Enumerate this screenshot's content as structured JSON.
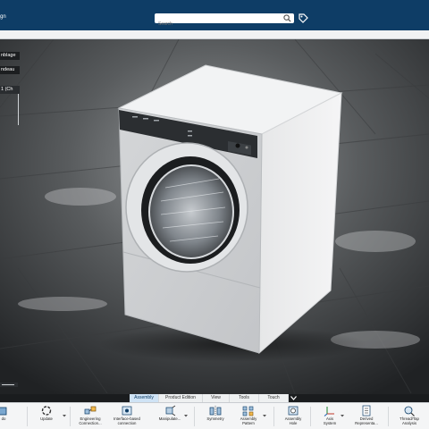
{
  "header": {
    "title_fragment": "gn",
    "search_placeholder": "Search",
    "tag_icon": "tag-icon",
    "search_icon": "search-icon"
  },
  "tree": {
    "items": [
      {
        "label": "nblage"
      },
      {
        "label": "ndeau"
      },
      {
        "label": "1 (Ch"
      }
    ]
  },
  "tabs": [
    {
      "label": "Assembly",
      "active": true
    },
    {
      "label": "Product Edition",
      "active": false
    },
    {
      "label": "View",
      "active": false
    },
    {
      "label": "Tools",
      "active": false
    },
    {
      "label": "Touch",
      "active": false
    }
  ],
  "toolbar": {
    "items": [
      {
        "line1": "do",
        "line2": "",
        "icon": "partial-icon"
      },
      {
        "line1": "Update",
        "line2": "",
        "icon": "update-icon"
      },
      {
        "line1": "Engineering",
        "line2": "Connection...",
        "icon": "engineering-connection-icon"
      },
      {
        "line1": "Interface-based",
        "line2": "connection",
        "icon": "interface-connection-icon"
      },
      {
        "line1": "Manipulate...",
        "line2": "",
        "icon": "manipulate-icon"
      },
      {
        "line1": "Symmetry",
        "line2": "",
        "icon": "symmetry-icon"
      },
      {
        "line1": "Assembly",
        "line2": "Pattern",
        "icon": "assembly-pattern-icon"
      },
      {
        "line1": "Assembly",
        "line2": "Hole",
        "icon": "assembly-hole-icon"
      },
      {
        "line1": "Axis",
        "line2": "System",
        "icon": "axis-system-icon"
      },
      {
        "line1": "Derived",
        "line2": "Representa...",
        "icon": "derived-representation-icon"
      },
      {
        "line1": "Thread/Tap",
        "line2": "Analysis",
        "icon": "thread-tap-analysis-icon"
      }
    ]
  },
  "colors": {
    "header": "#0e3d66",
    "toolbar": "#f4f5f6",
    "active_tab": "#cfe3f5"
  }
}
